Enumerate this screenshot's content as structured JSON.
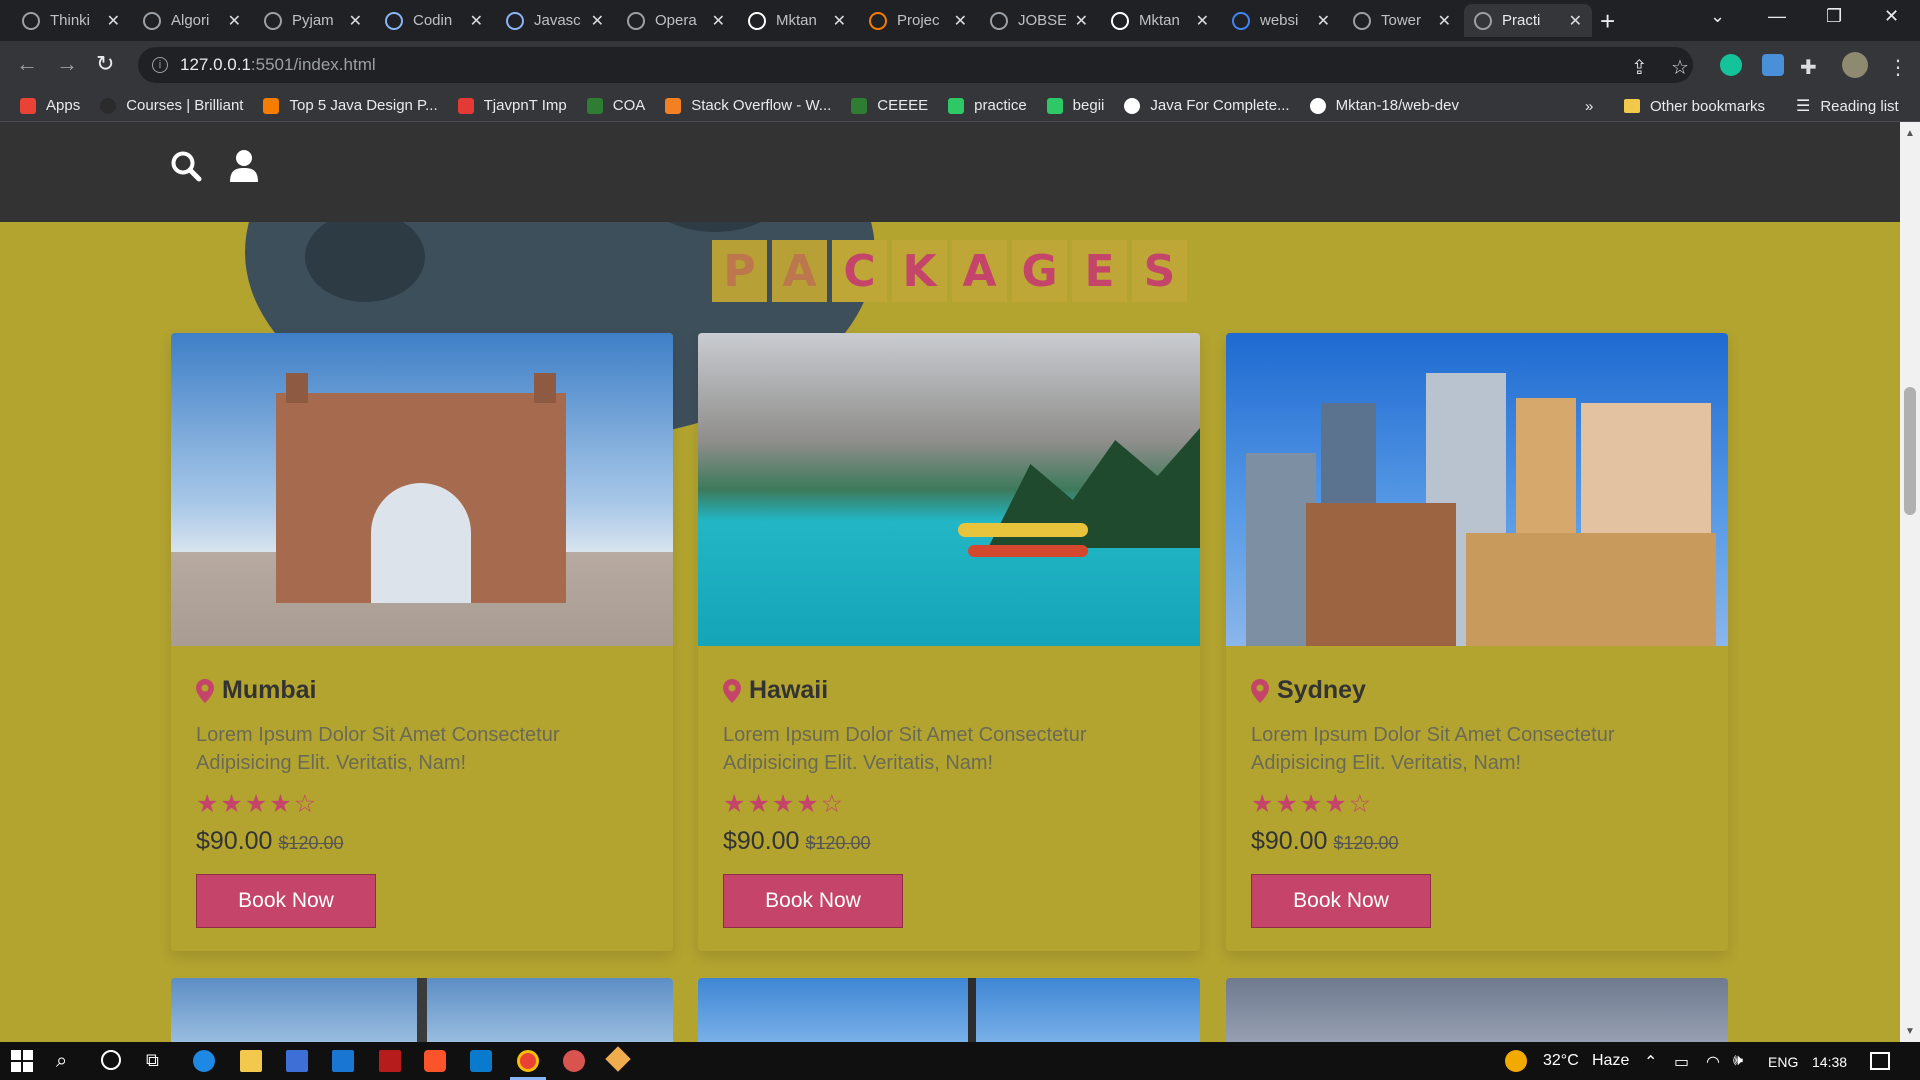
{
  "browser": {
    "tabs": [
      {
        "title": "Thinki",
        "icon": "globe-icon"
      },
      {
        "title": "Algori",
        "icon": "globe-icon"
      },
      {
        "title": "Pyjam",
        "icon": "globe-icon"
      },
      {
        "title": "Codin",
        "icon": "mountain-icon"
      },
      {
        "title": "Javasc",
        "icon": "mountain-icon"
      },
      {
        "title": "Opera",
        "icon": "globe-icon"
      },
      {
        "title": "Mktan",
        "icon": "github-icon"
      },
      {
        "title": "Projec",
        "icon": "orange-circle-icon"
      },
      {
        "title": "JOBSE",
        "icon": "globe-icon"
      },
      {
        "title": "Mktan",
        "icon": "github-icon"
      },
      {
        "title": "websi",
        "icon": "google-icon"
      },
      {
        "title": "Tower",
        "icon": "globe-icon"
      },
      {
        "title": "Practi",
        "icon": "globe-icon",
        "active": true
      }
    ],
    "url_host": "127.0.0.1",
    "url_rest": ":5501/index.html",
    "bookmarks": [
      {
        "label": "Apps",
        "icon": "apps-grid-icon",
        "color": "#ea4335"
      },
      {
        "label": "Courses | Brilliant",
        "icon": "brilliant-icon",
        "color": "#2b2b2b"
      },
      {
        "label": "Top 5 Java Design P...",
        "icon": "blogger-icon",
        "color": "#f57d00"
      },
      {
        "label": "TjavpnT Imp",
        "icon": "vpn-icon",
        "color": "#e53935"
      },
      {
        "label": "COA",
        "icon": "link-icon",
        "color": "#2e7d32"
      },
      {
        "label": "Stack Overflow - W...",
        "icon": "stackoverflow-icon",
        "color": "#f48024"
      },
      {
        "label": "CEEEE",
        "icon": "link-icon",
        "color": "#2e7d32"
      },
      {
        "label": "practice",
        "icon": "h-icon",
        "color": "#2ec866"
      },
      {
        "label": "begii",
        "icon": "b-icon",
        "color": "#2ec866"
      },
      {
        "label": "Java For Complete...",
        "icon": "globe-icon",
        "color": "#ffffff"
      },
      {
        "label": "Mktan-18/web-dev",
        "icon": "github-icon",
        "color": "#ffffff"
      }
    ],
    "bookmarks_more": "»",
    "other_bookmarks": "Other bookmarks",
    "reading_list": "Reading list"
  },
  "site": {
    "heading_letters": [
      "P",
      "A",
      "C",
      "K",
      "A",
      "G",
      "E",
      "S"
    ],
    "packages": [
      {
        "place": "Mumbai",
        "description": "Lorem Ipsum Dolor Sit Amet Consectetur Adipisicing Elit. Veritatis, Nam!",
        "rating": 4,
        "stars": "★★★★☆",
        "price": "$90.00",
        "old_price": "$120.00",
        "button": "Book Now"
      },
      {
        "place": "Hawaii",
        "description": "Lorem Ipsum Dolor Sit Amet Consectetur Adipisicing Elit. Veritatis, Nam!",
        "rating": 4,
        "stars": "★★★★☆",
        "price": "$90.00",
        "old_price": "$120.00",
        "button": "Book Now"
      },
      {
        "place": "Sydney",
        "description": "Lorem Ipsum Dolor Sit Amet Consectetur Adipisicing Elit. Veritatis, Nam!",
        "rating": 4,
        "stars": "★★★★☆",
        "price": "$90.00",
        "old_price": "$120.00",
        "button": "Book Now"
      }
    ],
    "colors": {
      "accent": "#c44569",
      "background": "#b3a430",
      "header": "#333333"
    }
  },
  "taskbar": {
    "weather": "32°C",
    "weather_desc": "Haze",
    "language": "ENG",
    "time": "14:38"
  }
}
